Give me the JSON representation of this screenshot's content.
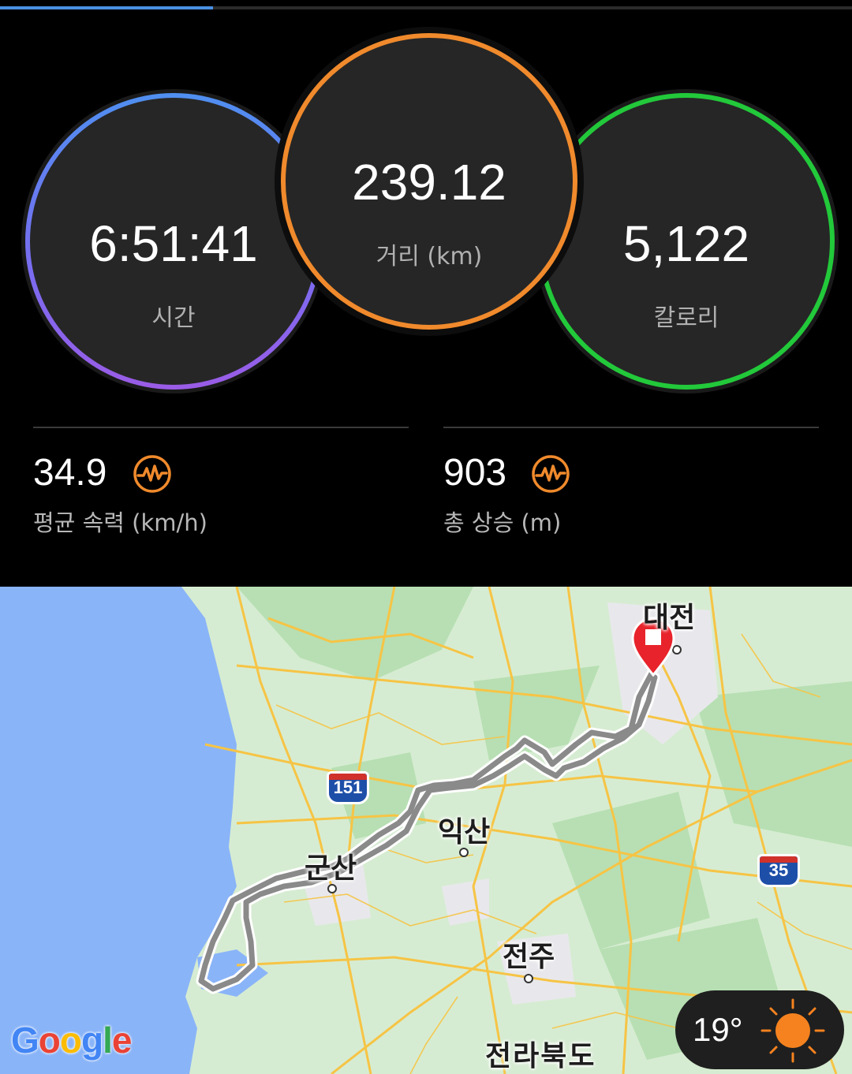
{
  "progress": {
    "fraction": 0.25,
    "color": "#4a90e2"
  },
  "rings": {
    "time": {
      "value": "6:51:41",
      "label": "시간",
      "color": "#5a7ef0"
    },
    "distance": {
      "value": "239.12",
      "label": "거리 (km)",
      "color": "#f08a2c"
    },
    "calories": {
      "value": "5,122",
      "label": "칼로리",
      "color": "#22c93a"
    }
  },
  "stats": {
    "avg_speed": {
      "value": "34.9",
      "label": "평균 속력 (km/h)",
      "icon": "heartbeat-icon"
    },
    "elevation": {
      "value": "903",
      "label": "총 상승 (m)",
      "icon": "heartbeat-icon"
    }
  },
  "map": {
    "cities": {
      "daejeon": "대전",
      "iksan": "익산",
      "gunsan": "군산",
      "jeonju": "전주",
      "province": "전라북도"
    },
    "highways": {
      "h151": "151",
      "h35": "35"
    },
    "logo": [
      "G",
      "o",
      "o",
      "g",
      "l",
      "e"
    ],
    "logo_colors": [
      "#4285f4",
      "#ea4335",
      "#fbbc05",
      "#4285f4",
      "#34a853",
      "#ea4335"
    ],
    "route_color": "#8a8a8a",
    "marker_color": "#e8232b"
  },
  "weather": {
    "temp": "19°",
    "icon": "sun-icon",
    "icon_color": "#f5821f"
  }
}
